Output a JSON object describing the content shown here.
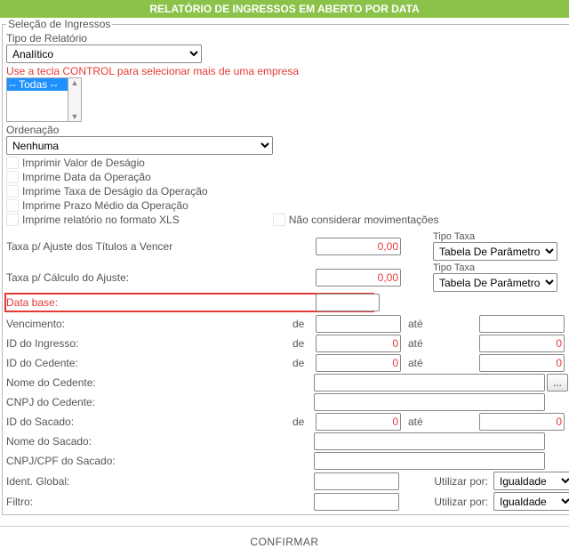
{
  "title": "RELATÓRIO DE INGRESSOS EM ABERTO POR DATA",
  "fieldset_legend": "Seleção de Ingressos",
  "tipo_relatorio_label": "Tipo de Relatório",
  "tipo_relatorio_value": "Analítico",
  "control_hint": "Use a tecla CONTROL para selecionar mais de uma empresa",
  "empresas_selected": "-- Todas --",
  "ordenacao_label": "Ordenação",
  "ordenacao_value": "Nenhuma",
  "cb_valor_desagio": "Imprimir Valor de Deságio",
  "cb_data_operacao": "Imprime Data da Operação",
  "cb_taxa_desagio": "Imprime Taxa de Deságio da Operação",
  "cb_prazo_medio": "Imprime Prazo Médio da Operação",
  "cb_formato_xls": "Imprime relatório no formato XLS",
  "cb_nao_considerar": "Não considerar movimentações",
  "rows": {
    "taxa_ajuste": {
      "label": "Taxa p/ Ajuste dos Títulos a Vencer",
      "value": "0,00",
      "tipo_taxa_label": "Tipo Taxa",
      "tipo_taxa_value": "Tabela De Parâmetros"
    },
    "taxa_calculo": {
      "label": "Taxa p/ Cálculo do Ajuste:",
      "value": "0,00",
      "tipo_taxa_label": "Tipo Taxa",
      "tipo_taxa_value": "Tabela De Parâmetros"
    },
    "data_base": {
      "label": "Data base:",
      "value": ""
    },
    "vencimento": {
      "label": "Vencimento:",
      "de": "de",
      "ate": "até",
      "v1": "",
      "v2": ""
    },
    "id_ingresso": {
      "label": "ID do Ingresso:",
      "de": "de",
      "ate": "até",
      "v1": "0",
      "v2": "0"
    },
    "id_cedente": {
      "label": "ID do Cedente:",
      "de": "de",
      "ate": "até",
      "v1": "0",
      "v2": "0"
    },
    "nome_cedente": {
      "label": "Nome do Cedente:",
      "value": ""
    },
    "cnpj_cedente": {
      "label": "CNPJ do Cedente:",
      "value": ""
    },
    "id_sacado": {
      "label": "ID do Sacado:",
      "de": "de",
      "ate": "até",
      "v1": "0",
      "v2": "0"
    },
    "nome_sacado": {
      "label": "Nome do Sacado:",
      "value": ""
    },
    "cnpj_sacado": {
      "label": "CNPJ/CPF do Sacado:",
      "value": ""
    },
    "ident_global": {
      "label": "Ident. Global:",
      "util_label": "Utilizar por:",
      "util_value": "Igualdade",
      "value": ""
    },
    "filtro": {
      "label": "Filtro:",
      "util_label": "Utilizar por:",
      "util_value": "Igualdade",
      "value": ""
    }
  },
  "confirm_label": "CONFIRMAR",
  "browse_btn": "..."
}
